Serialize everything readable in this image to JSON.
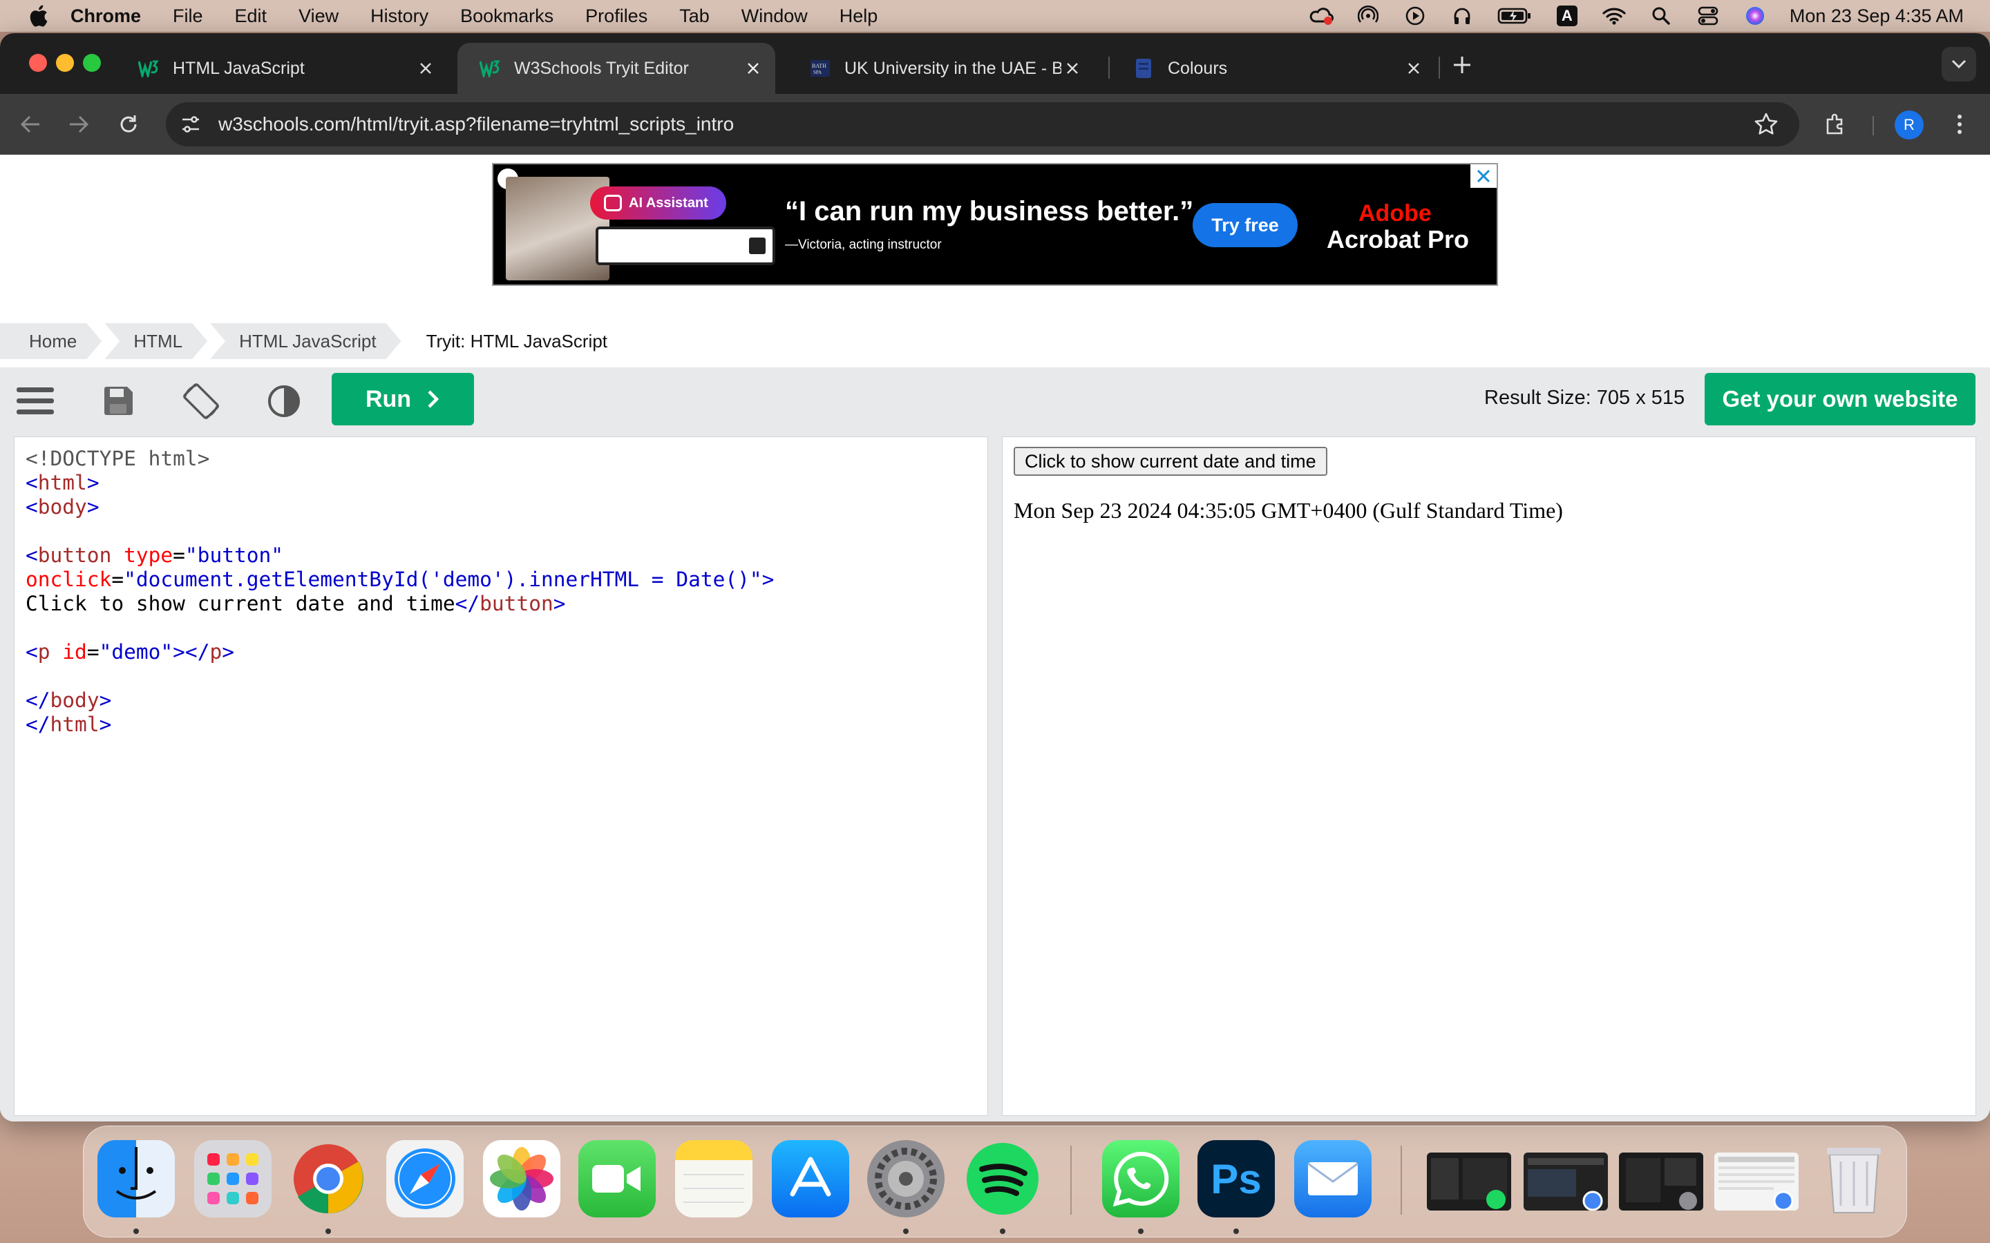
{
  "menubar": {
    "app_name": "Chrome",
    "items": [
      "File",
      "Edit",
      "View",
      "History",
      "Bookmarks",
      "Profiles",
      "Tab",
      "Window",
      "Help"
    ],
    "status_icons": [
      "creative-cloud-icon",
      "airdrop-icon",
      "play-icon",
      "headphones-icon",
      "battery-icon",
      "input-source-icon",
      "wifi-icon",
      "spotlight-icon",
      "control-center-icon",
      "siri-icon"
    ],
    "input_source": "A",
    "clock": "Mon 23 Sep  4:35 AM"
  },
  "browser": {
    "tabs": [
      {
        "title": "HTML JavaScript",
        "favicon": "w3schools-favicon",
        "active": false
      },
      {
        "title": "W3Schools Tryit Editor",
        "favicon": "w3schools-favicon",
        "active": true
      },
      {
        "title": "UK University in the UAE - Ba",
        "favicon": "bath-spa-favicon",
        "active": false
      },
      {
        "title": "Colours",
        "favicon": "doc-favicon",
        "active": false
      }
    ],
    "url": "w3schools.com/html/tryit.asp?filename=tryhtml_scripts_intro",
    "profile_initial": "R"
  },
  "ad": {
    "badge": "AI Assistant",
    "quote": "“I can run my business better.”",
    "attribution": "—Victoria, acting instructor",
    "cta": "Try free",
    "brand_line1": "Adobe",
    "brand_line2": "Acrobat Pro"
  },
  "breadcrumb": [
    "Home",
    "HTML",
    "HTML JavaScript",
    "Tryit: HTML JavaScript"
  ],
  "tryit": {
    "run_label": "Run",
    "result_size": "Result Size: 705 x 515",
    "get_website": "Get your own website",
    "result_button": "Click to show current date and time",
    "result_output": "Mon Sep 23 2024 04:35:05 GMT+0400 (Gulf Standard Time)"
  },
  "dock": {
    "apps": [
      "Finder",
      "Launchpad",
      "Google Chrome",
      "Safari",
      "Photos",
      "FaceTime",
      "Notes",
      "App Store",
      "System Settings",
      "Spotify",
      "WhatsApp",
      "Photoshop",
      "Mail"
    ],
    "ps_label": "Ps"
  },
  "colors": {
    "w3_green": "#04aa6d",
    "chrome_dark": "#1f1f1f",
    "adobe_red": "#fa0f00"
  }
}
